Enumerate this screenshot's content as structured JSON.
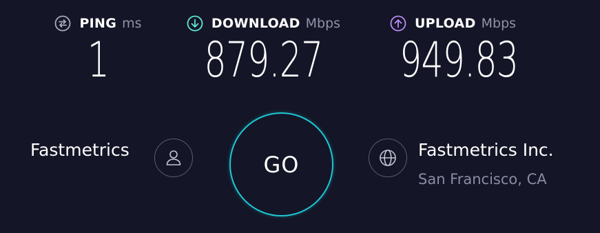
{
  "metrics": {
    "ping": {
      "label": "PING",
      "unit": "ms",
      "value": "1",
      "icon": "ping-icon",
      "color": "#a8aac0"
    },
    "download": {
      "label": "DOWNLOAD",
      "unit": "Mbps",
      "value": "879.27",
      "icon": "download-arrow-icon",
      "color": "#5ee8d6"
    },
    "upload": {
      "label": "UPLOAD",
      "unit": "Mbps",
      "value": "949.83",
      "icon": "upload-arrow-icon",
      "color": "#b98cf5"
    }
  },
  "go_button": {
    "label": "GO",
    "ring_color": "#1fc7d4"
  },
  "isp": {
    "name": "Fastmetrics",
    "icon": "user-icon"
  },
  "server": {
    "name": "Fastmetrics Inc.",
    "location": "San Francisco, CA",
    "icon": "globe-icon"
  },
  "colors": {
    "background": "#141526",
    "muted_text": "#8a8ca3"
  }
}
